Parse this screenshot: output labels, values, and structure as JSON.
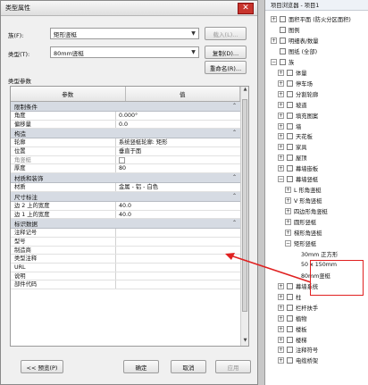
{
  "dialog": {
    "title": "类型属性",
    "close_label": "✕",
    "family_label": "族(F):",
    "family_value": "矩形竖梃",
    "type_label": "类型(T):",
    "type_value": "80mm竖梃",
    "load_btn": "载入(L)...",
    "duplicate_btn": "复制(D)...",
    "rename_btn": "重命名(R)...",
    "type_params_label": "类型参数",
    "col_param": "参数",
    "col_value": "值",
    "preview_btn": "<< 预览(P)",
    "ok_btn": "确定",
    "cancel_btn": "取消",
    "apply_btn": "应用",
    "groups": [
      {
        "name": "限制条件",
        "rows": [
          {
            "param": "角度",
            "value": "0.000°"
          },
          {
            "param": "偏移量",
            "value": "0.0"
          }
        ]
      },
      {
        "name": "构造",
        "rows": [
          {
            "param": "轮廓",
            "value": "系统竖梃轮廓: 矩形"
          },
          {
            "param": "位置",
            "value": "垂直于面"
          },
          {
            "param": "角竖梃",
            "value": "",
            "checkbox": true,
            "dim": true
          },
          {
            "param": "厚度",
            "value": "80"
          }
        ]
      },
      {
        "name": "材质和装饰",
        "rows": [
          {
            "param": "材质",
            "value": "金属 - 铝 - 白色"
          }
        ]
      },
      {
        "name": "尺寸标注",
        "rows": [
          {
            "param": "边 2 上的宽度",
            "value": "40.0"
          },
          {
            "param": "边 1 上的宽度",
            "value": "40.0"
          }
        ]
      },
      {
        "name": "标识数据",
        "rows": [
          {
            "param": "注释记号",
            "value": ""
          },
          {
            "param": "型号",
            "value": ""
          },
          {
            "param": "制造商",
            "value": ""
          },
          {
            "param": "类型注释",
            "value": ""
          },
          {
            "param": "URL",
            "value": ""
          },
          {
            "param": "说明",
            "value": ""
          },
          {
            "param": "部件代码",
            "value": ""
          }
        ]
      }
    ]
  },
  "tree": {
    "header": "项目浏览器 - 项目1",
    "items": [
      {
        "label": "面积平面 (防火分区面积)",
        "indent": 0,
        "exp": "+"
      },
      {
        "label": "图例",
        "indent": 0,
        "exp": ""
      },
      {
        "label": "明细表/数量",
        "indent": 0,
        "exp": "+"
      },
      {
        "label": "图纸 (全部)",
        "indent": 0,
        "exp": ""
      },
      {
        "label": "族",
        "indent": 0,
        "exp": "-"
      },
      {
        "label": "体量",
        "indent": 1,
        "exp": "+"
      },
      {
        "label": "停车场",
        "indent": 1,
        "exp": "+"
      },
      {
        "label": "分割轮廓",
        "indent": 1,
        "exp": "+"
      },
      {
        "label": "坡道",
        "indent": 1,
        "exp": "+"
      },
      {
        "label": "填充图案",
        "indent": 1,
        "exp": "+"
      },
      {
        "label": "墙",
        "indent": 1,
        "exp": "+"
      },
      {
        "label": "天花板",
        "indent": 1,
        "exp": "+"
      },
      {
        "label": "家具",
        "indent": 1,
        "exp": "+"
      },
      {
        "label": "屋顶",
        "indent": 1,
        "exp": "+"
      },
      {
        "label": "幕墙嵌板",
        "indent": 1,
        "exp": "+"
      },
      {
        "label": "幕墙竖梃",
        "indent": 1,
        "exp": "-"
      },
      {
        "label": "L 形角竖梃",
        "indent": 2,
        "exp": "+"
      },
      {
        "label": "V 形角竖梃",
        "indent": 2,
        "exp": "+"
      },
      {
        "label": "四边形角竖梃",
        "indent": 2,
        "exp": "+"
      },
      {
        "label": "圆形竖梃",
        "indent": 2,
        "exp": "+"
      },
      {
        "label": "梯形角竖梃",
        "indent": 2,
        "exp": "+"
      },
      {
        "label": "矩形竖梃",
        "indent": 2,
        "exp": "-"
      },
      {
        "label": "30mm 正方形",
        "indent": 3,
        "exp": ""
      },
      {
        "label": "50 x 150mm",
        "indent": 3,
        "exp": ""
      },
      {
        "label": "80mm竖梃",
        "indent": 3,
        "exp": ""
      },
      {
        "label": "幕墙系统",
        "indent": 1,
        "exp": "+"
      },
      {
        "label": "柱",
        "indent": 1,
        "exp": "+"
      },
      {
        "label": "栏杆扶手",
        "indent": 1,
        "exp": "+"
      },
      {
        "label": "植物",
        "indent": 1,
        "exp": "+"
      },
      {
        "label": "楼板",
        "indent": 1,
        "exp": "+"
      },
      {
        "label": "楼梯",
        "indent": 1,
        "exp": "+"
      },
      {
        "label": "注释符号",
        "indent": 1,
        "exp": "+"
      },
      {
        "label": "电缆桥架",
        "indent": 1,
        "exp": "+"
      }
    ]
  },
  "colors": {
    "annotation": "#e02020",
    "group_bg": "#d6dbe3"
  }
}
